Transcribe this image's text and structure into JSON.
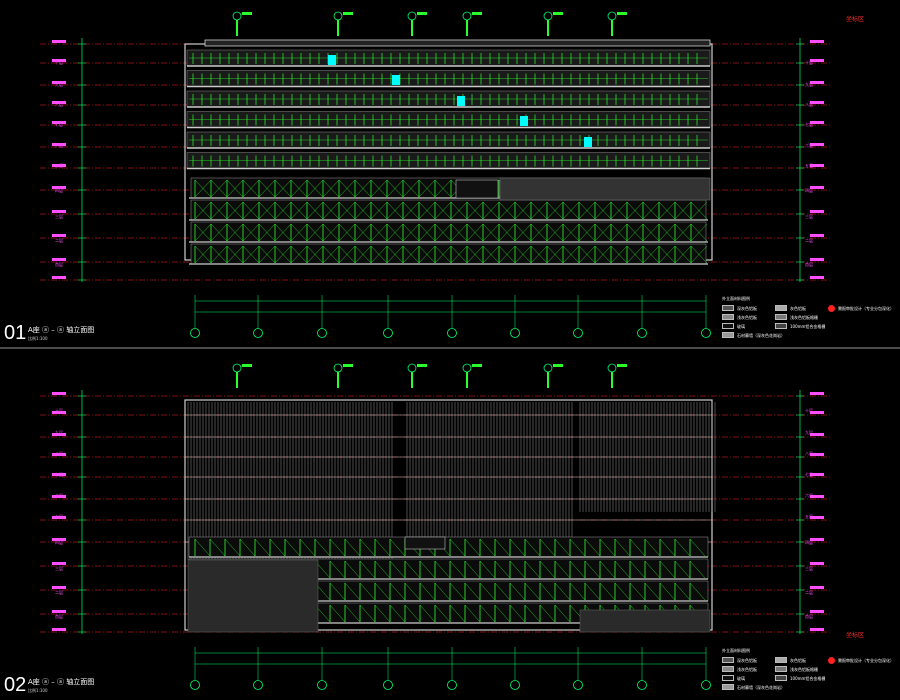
{
  "drawings": [
    {
      "id": "01",
      "title": "A座 ⓐ – ⓐ 轴立面图",
      "subtitle": "比例1:100",
      "note": "坐标区"
    },
    {
      "id": "02",
      "title": "A座 ⓐ – ⓐ 轴立面图",
      "subtitle": "比例1:100",
      "note": "坐标区"
    }
  ],
  "floor_labels": [
    "十层",
    "九层",
    "八层",
    "七层",
    "六层",
    "五层",
    "四层",
    "三层",
    "二层",
    "首层"
  ],
  "legend": {
    "title": "外立面材料图例",
    "items": [
      "深灰色铝板",
      "浅灰色铝板",
      "玻璃",
      "石材幕墙（深灰色花岗岩）",
      "灰色铝板",
      "浅灰色铝板格栅",
      "100mm铝合金格栅"
    ],
    "special": "需报审批设计（专业分包深化）"
  },
  "colors": {
    "background": "#000000",
    "structure": "#cfcfcf",
    "glazing": "#2bff2b",
    "grid_red": "#ff2020",
    "grid_green": "#00ff66",
    "cyan": "#00ffff",
    "magenta": "#ff4dff"
  }
}
